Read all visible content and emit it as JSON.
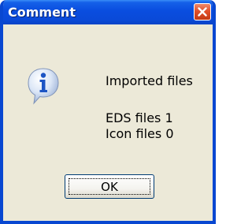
{
  "window": {
    "title": "Comment"
  },
  "icon": {
    "name": "information-icon"
  },
  "message": {
    "line1": "Imported files",
    "line2": "EDS files  1",
    "line3": "Icon files  0"
  },
  "buttons": {
    "ok_label": "OK"
  },
  "colors": {
    "titlebar": "#0a4ddf",
    "window_bg": "#ece9d8",
    "close_button": "#e2502a",
    "button_border": "#003c74"
  }
}
